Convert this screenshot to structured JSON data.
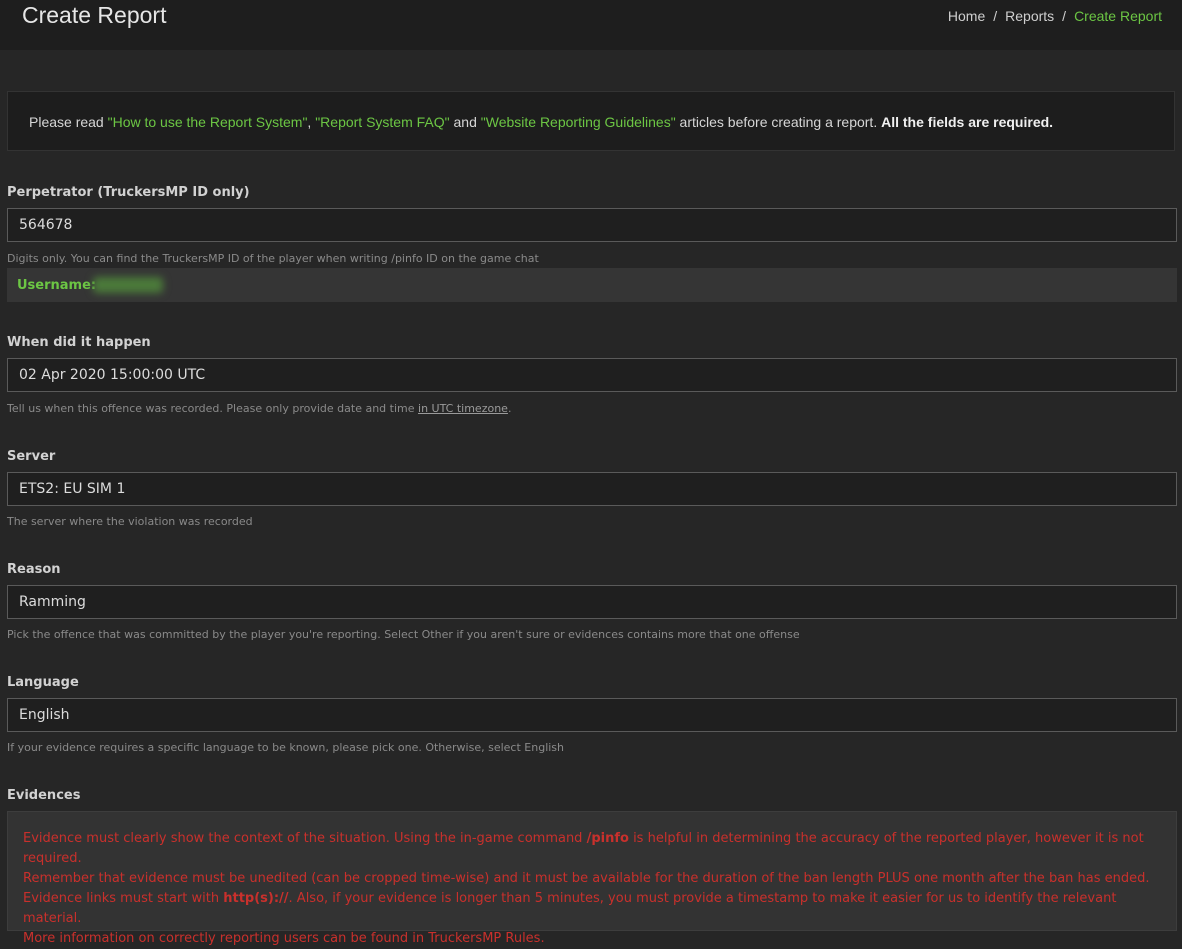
{
  "header": {
    "title": "Create Report",
    "breadcrumb": [
      "Home",
      "Reports",
      "Create Report"
    ],
    "separator": "/"
  },
  "notice": {
    "prefix": "Please read ",
    "link1": "\"How to use the Report System\"",
    "comma1": ", ",
    "link2": "\"Report System FAQ\"",
    "and": " and ",
    "link3": "\"Website Reporting Guidelines\"",
    "suffix": " articles before creating a report. ",
    "bold": "All the fields are required."
  },
  "perpetrator": {
    "label": "Perpetrator (TruckersMP ID only)",
    "value": "564678",
    "help": "Digits only. You can find the TruckersMP ID of the player when writing /pinfo ID on the game chat",
    "username_label": "Username:"
  },
  "when": {
    "label": "When did it happen",
    "value": "02 Apr 2020 15:00:00 UTC",
    "help_prefix": "Tell us when this offence was recorded. Please only provide date and time ",
    "help_link": "in UTC timezone",
    "help_suffix": "."
  },
  "server": {
    "label": "Server",
    "value": "ETS2: EU SIM 1",
    "help": "The server where the violation was recorded"
  },
  "reason": {
    "label": "Reason",
    "value": "Ramming",
    "help": "Pick the offence that was committed by the player you're reporting. Select Other if you aren't sure or evidences contains more that one offense"
  },
  "language": {
    "label": "Language",
    "value": "English",
    "help": "If your evidence requires a specific language to be known, please pick one. Otherwise, select English"
  },
  "evidences": {
    "label": "Evidences",
    "line1_a": "Evidence must clearly show the context of the situation. Using the in-game command ",
    "line1_b": "/pinfo",
    "line1_c": " is helpful in determining the accuracy of the reported player, however it is not required.",
    "line2": "Remember that evidence must be unedited (can be cropped time-wise) and it must be available for the duration of the ban length PLUS one month after the ban has ended. Evidence links must start with ",
    "line2_b": "http(s)://",
    "line2_c": ". Also, if your evidence is longer than 5 minutes, you must provide a timestamp to make it easier for us to identify the relevant material.",
    "line3": "More information on correctly reporting users can be found in TruckersMP Rules."
  },
  "colors": {
    "accent": "#6cc644",
    "background": "#262626",
    "warning_text": "#c9302c"
  }
}
